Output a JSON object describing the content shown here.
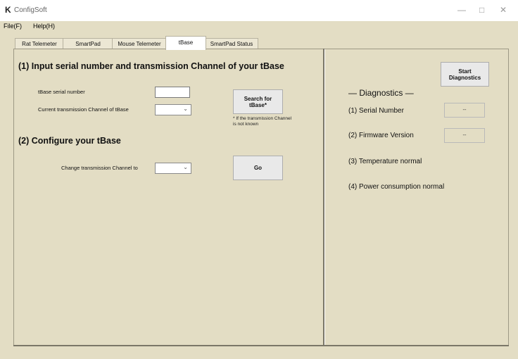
{
  "app": {
    "title": "ConfigSoft",
    "logo_glyph": "K"
  },
  "window_controls": {
    "minimize": "—",
    "maximize": "□",
    "close": "✕"
  },
  "menu": {
    "file": "File(F)",
    "help": "Help(H)"
  },
  "tabs": [
    "Rat Telemeter",
    "SmartPad",
    "Mouse Telemeter",
    "tBase",
    "SmartPad Status"
  ],
  "active_tab": "tBase",
  "left": {
    "section1_title": "(1) Input serial number and transmission Channel of your tBase",
    "serial_label": "tBase serial number",
    "serial_value": "",
    "channel_label": "Current transmission Channel of tBase",
    "channel_value": "",
    "search_button": "Search for tBase*",
    "search_note": "* If the transmission Channel is not known",
    "section2_title": "(2) Configure your tBase",
    "change_label": "Change transmission Channel to",
    "change_value": "",
    "go_button": "Go"
  },
  "right": {
    "diag_title": "— Diagnostics —",
    "start_button": "Start Diagnostics",
    "serial_label": "(1) Serial Number",
    "serial_value": "--",
    "firmware_label": "(2) Firmware Version",
    "firmware_value": "--",
    "temp_label": "(3) Temperature normal",
    "power_label": "(4) Power consumption normal"
  },
  "colors": {
    "window_bg": "#e3ddc4",
    "active_tab_bg": "#ffffff"
  }
}
